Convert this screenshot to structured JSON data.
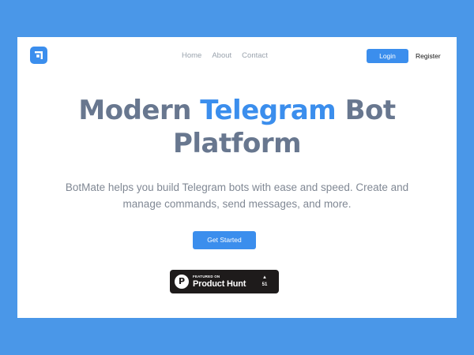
{
  "header": {
    "logo_icon": "app-logo-icon",
    "nav": [
      {
        "label": "Home"
      },
      {
        "label": "About"
      },
      {
        "label": "Contact"
      }
    ],
    "login_label": "Login",
    "register_label": "Register"
  },
  "hero": {
    "title_part1": "Modern ",
    "title_accent": "Telegram",
    "title_part2": " Bot",
    "title_line2": "Platform",
    "subtitle": "BotMate helps you build Telegram bots with ease and speed. Create and manage commands, send messages, and more.",
    "cta_label": "Get Started"
  },
  "product_hunt": {
    "icon": "product-hunt-logo-icon",
    "logo_letter": "P",
    "featured_label": "FEATURED ON",
    "name": "Product Hunt",
    "upvote_icon": "upvote-arrow-icon",
    "upvotes": "51"
  },
  "colors": {
    "frame": "#4a97e8",
    "primary": "#3b8eed",
    "title_text": "#68778f",
    "body_text": "#808894",
    "badge_bg": "#1e1b1b"
  }
}
